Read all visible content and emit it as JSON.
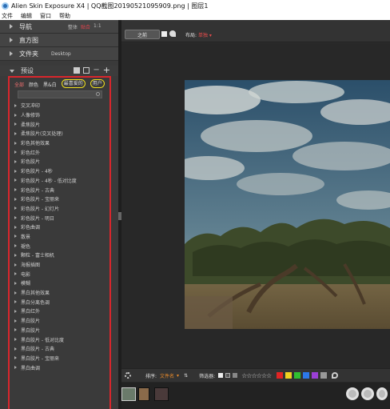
{
  "window": {
    "title": "Alien Skin Exposure X4 | QQ截图20190521095909.png | 图层1"
  },
  "menu": [
    "文件",
    "编辑",
    "窗口",
    "帮助"
  ],
  "sidebar": {
    "navigator": {
      "label": "导航",
      "options": [
        "整体",
        "贴合",
        "1:1"
      ],
      "active": "贴合"
    },
    "histogram": {
      "label": "直方图"
    },
    "folders": {
      "label": "文件夹",
      "value": "Desktop"
    },
    "presets": {
      "label": "预设",
      "filter_tabs": [
        "全部",
        "颜色",
        "黑&白",
        "最喜爱的",
        "用户"
      ],
      "active_tab": "全部",
      "highlighted_tabs": [
        "最喜爱的",
        "用户"
      ],
      "search_placeholder": "",
      "items": [
        "交叉冲印",
        "人像修饰",
        "柔焦胶片",
        "柔焦胶片(交叉处理)",
        "彩色其他效果",
        "彩色红外",
        "彩色胶片",
        "彩色胶片 - 4秒",
        "彩色胶片 - 4秒 - 低对比度",
        "彩色胶片 - 古典",
        "彩色胶片 - 宝丽来",
        "彩色胶片 - 幻灯片",
        "彩色胶片 - 明日",
        "彩色曲调",
        "散景",
        "褪色",
        "颗粒 - 富士相机",
        "海报插图",
        "电影",
        "模糊",
        "黑白其他效果",
        "黑白分离色调",
        "黑白红外",
        "黑白胶片",
        "黑白胶片",
        "黑白胶片 - 低对比度",
        "黑白胶片 - 古典",
        "黑白胶片 - 宝丽来",
        "黑白曲调"
      ]
    }
  },
  "toolbar": {
    "before_label": "之前",
    "compare_label": "布局:",
    "compare_value": "单独"
  },
  "bottombar": {
    "sort_label": "排序:",
    "sort_value": "文件名",
    "filter_label": "筛选器:",
    "stars": "☆☆☆☆☆☆",
    "color_labels": [
      "#e02424",
      "#f0d020",
      "#30c030",
      "#2c78e8",
      "#9b3fd6",
      "#999999"
    ]
  },
  "filmstrip": {
    "thumbnails": [
      "tree-photo",
      "tree-photo-2",
      "portrait"
    ]
  }
}
